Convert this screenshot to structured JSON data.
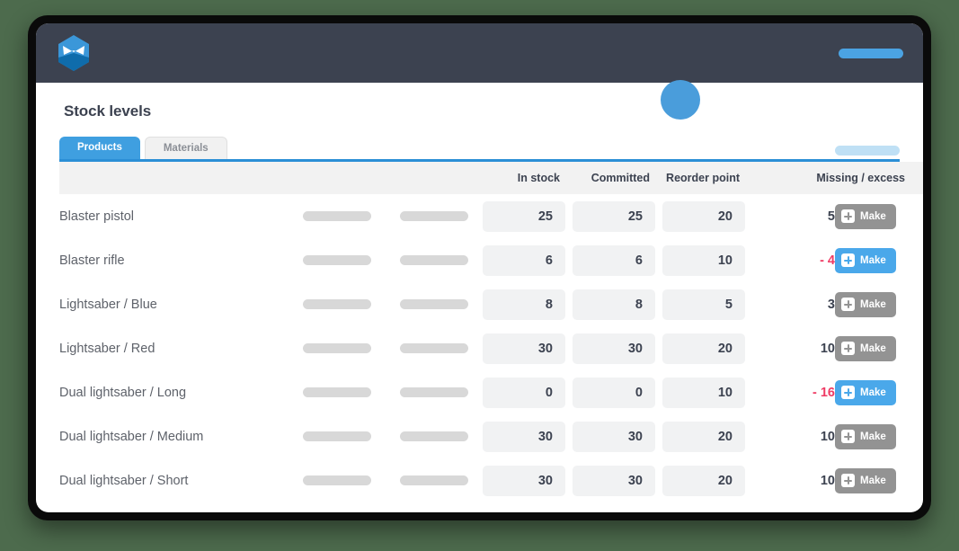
{
  "app": {
    "logo_icon": "hexagon-mask-logo",
    "header_pill_color": "#4ba3e3",
    "header_bg": "#3c4250"
  },
  "cursor": {
    "icon": "circle-cursor",
    "color": "#4a9ddb"
  },
  "page": {
    "title": "Stock levels"
  },
  "tabs": {
    "items": [
      {
        "label": "Products",
        "active": true
      },
      {
        "label": "Materials",
        "active": false
      }
    ],
    "right_pill_color": "#bfe0f5",
    "underline_color": "#2b8fd6"
  },
  "table": {
    "headers": {
      "name": "",
      "placeholder_a": "",
      "placeholder_b": "",
      "in_stock": "In stock",
      "committed": "Committed",
      "reorder_point": "Reorder point",
      "missing_excess": "Missing / excess",
      "action": ""
    },
    "action_label": "Make",
    "action_icon": "plus-square-icon",
    "rows": [
      {
        "name": "Blaster pistol",
        "in_stock": "25",
        "committed": "25",
        "reorder_point": "20",
        "missing_excess": "5",
        "negative": false,
        "action_primary": false
      },
      {
        "name": "Blaster rifle",
        "in_stock": "6",
        "committed": "6",
        "reorder_point": "10",
        "missing_excess": "- 4",
        "negative": true,
        "action_primary": true
      },
      {
        "name": "Lightsaber / Blue",
        "in_stock": "8",
        "committed": "8",
        "reorder_point": "5",
        "missing_excess": "3",
        "negative": false,
        "action_primary": false
      },
      {
        "name": "Lightsaber / Red",
        "in_stock": "30",
        "committed": "30",
        "reorder_point": "20",
        "missing_excess": "10",
        "negative": false,
        "action_primary": false
      },
      {
        "name": "Dual lightsaber / Long",
        "in_stock": "0",
        "committed": "0",
        "reorder_point": "10",
        "missing_excess": "- 16",
        "negative": true,
        "action_primary": true
      },
      {
        "name": "Dual lightsaber / Medium",
        "in_stock": "30",
        "committed": "30",
        "reorder_point": "20",
        "missing_excess": "10",
        "negative": false,
        "action_primary": false
      },
      {
        "name": "Dual lightsaber / Short",
        "in_stock": "30",
        "committed": "30",
        "reorder_point": "20",
        "missing_excess": "10",
        "negative": false,
        "action_primary": false
      }
    ]
  }
}
